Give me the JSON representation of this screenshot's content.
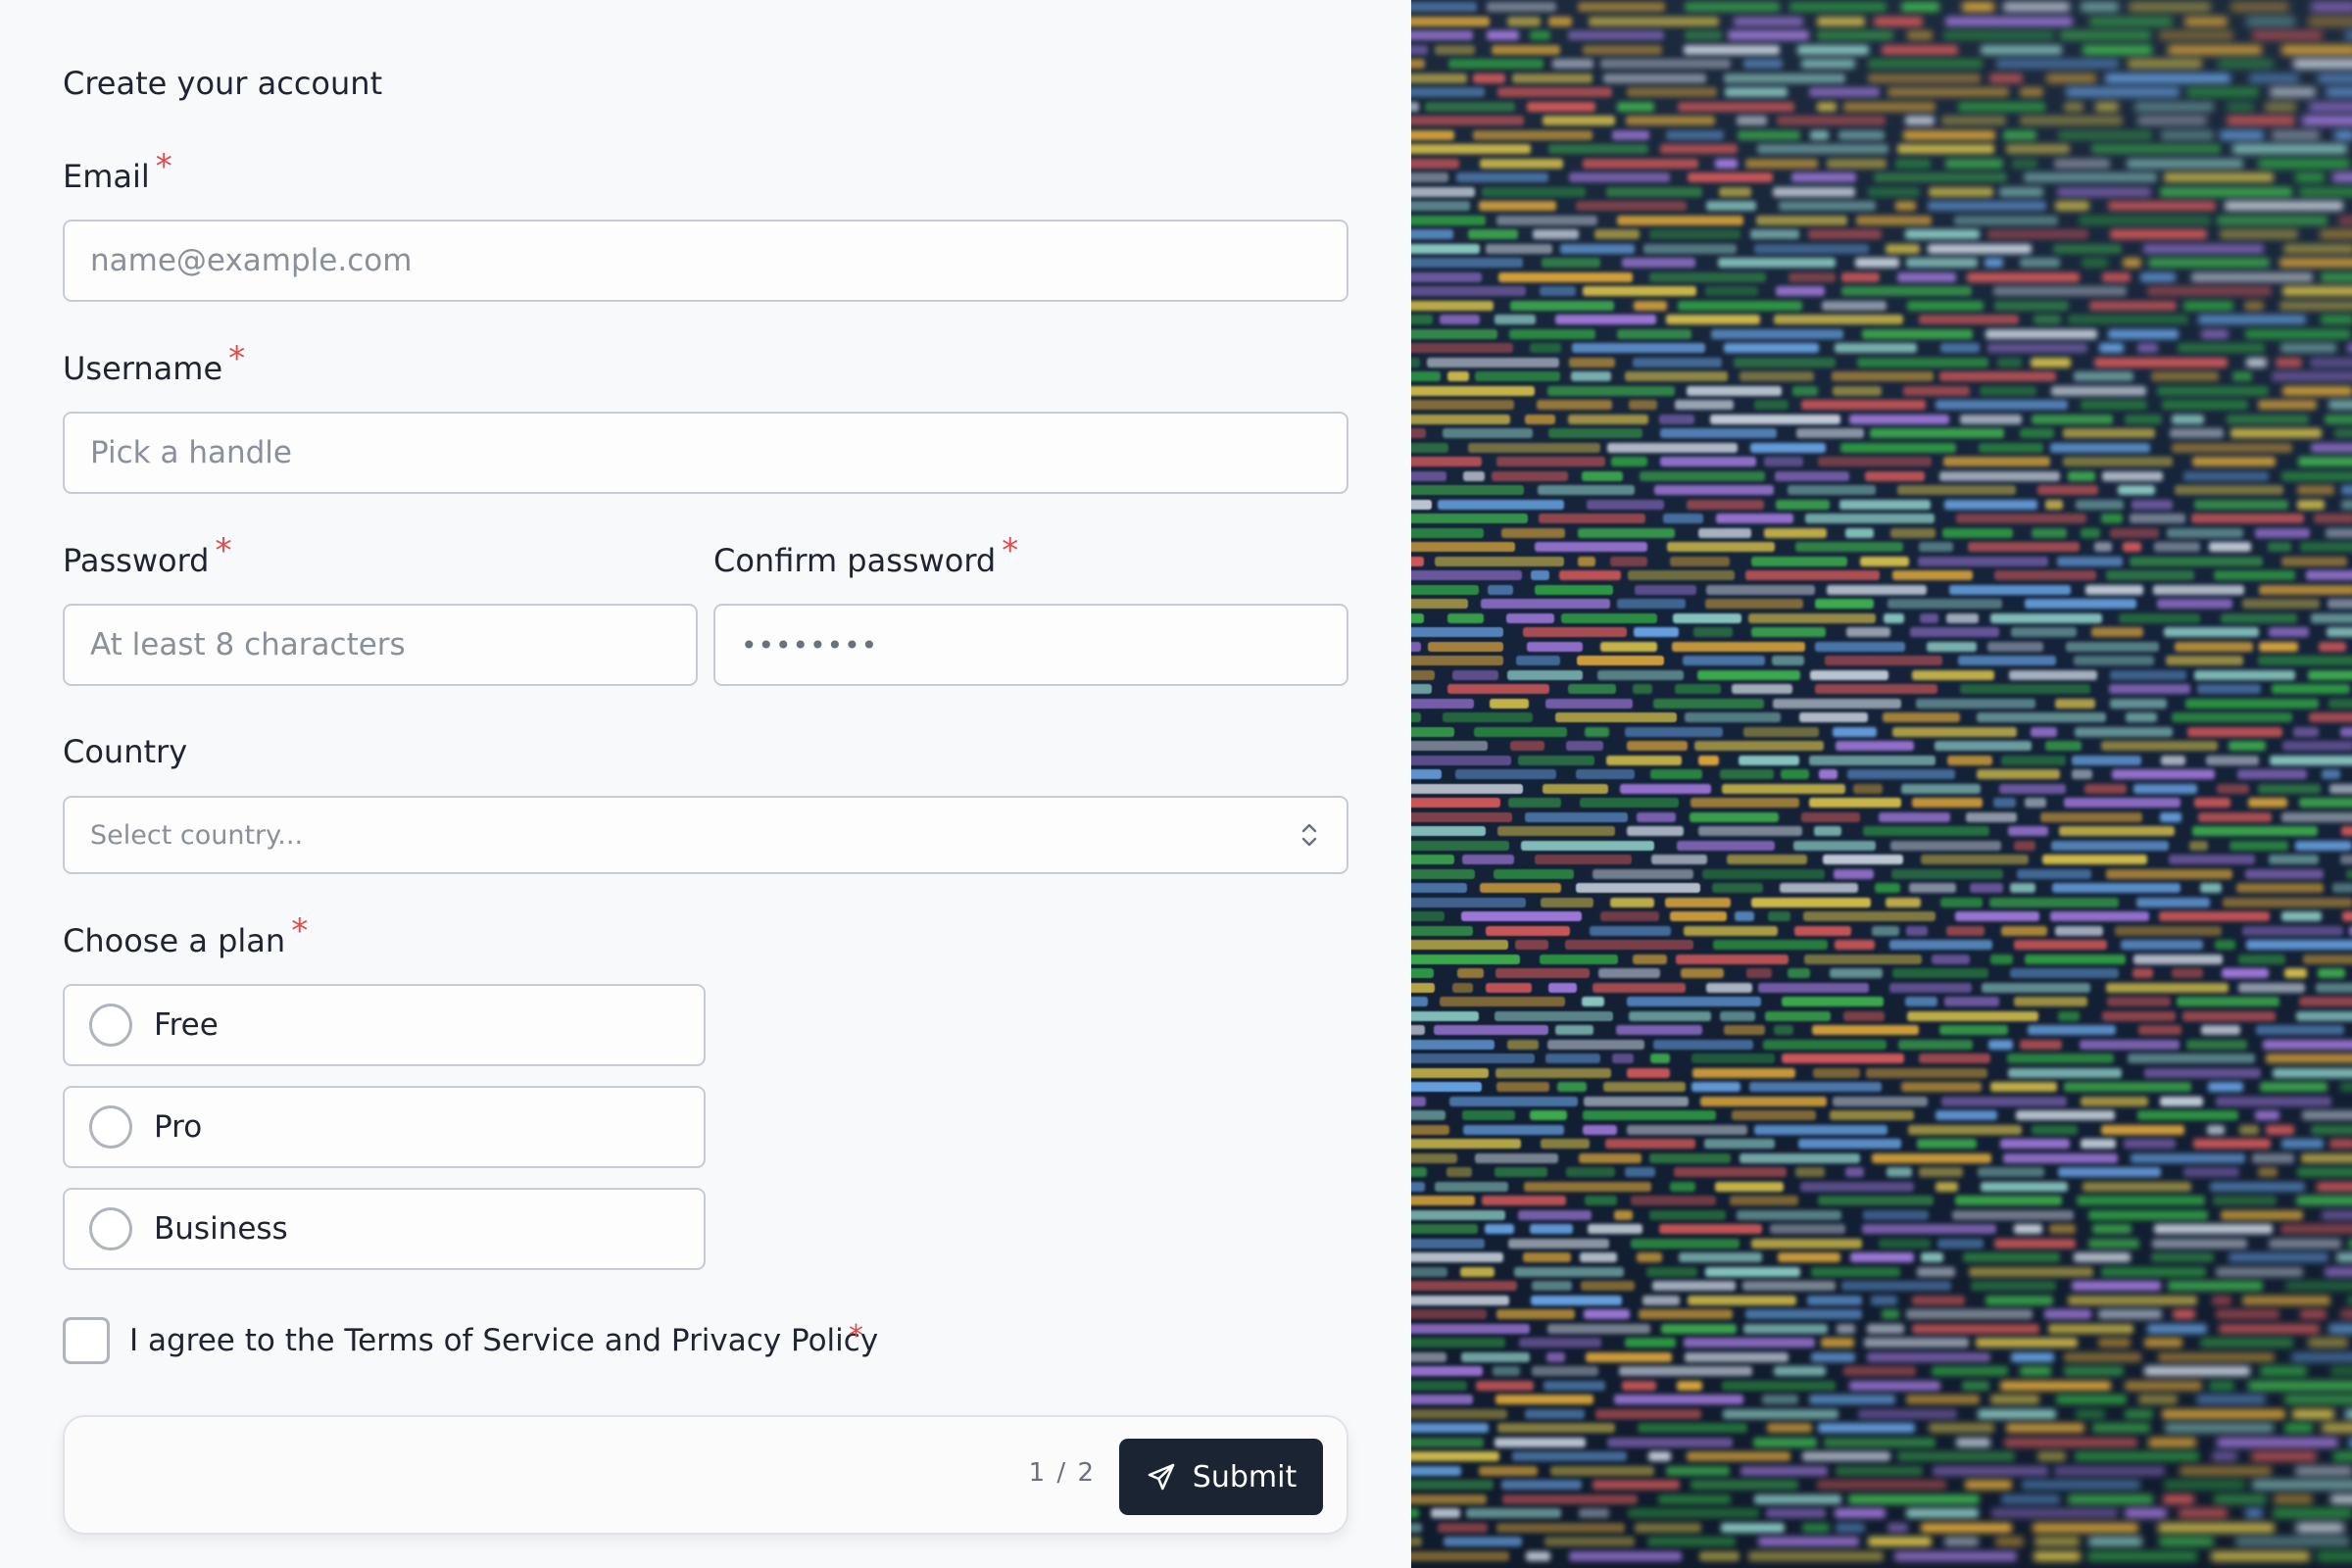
{
  "form": {
    "title": "Create your account",
    "email": {
      "label": "Email",
      "required_mark": "*",
      "placeholder": "name@example.com"
    },
    "username": {
      "label": "Username",
      "required_mark": "*",
      "placeholder": "Pick a handle"
    },
    "password": {
      "label": "Password",
      "required_mark": "*",
      "placeholder": "At least 8 characters"
    },
    "confirm_password": {
      "label": "Confirm password",
      "required_mark": "*",
      "value": "••••••••"
    },
    "country": {
      "label": "Country",
      "placeholder": "Select country...",
      "icon": "chevron-up-down-icon"
    },
    "plan": {
      "label": "Choose a plan",
      "required_mark": "*",
      "options": [
        {
          "label": "Free",
          "selected": false
        },
        {
          "label": "Pro",
          "selected": false
        },
        {
          "label": "Business",
          "selected": false
        }
      ]
    },
    "terms": {
      "label": "I agree to the Terms of Service and Privacy Policy",
      "required_mark": "*",
      "checked": false
    },
    "footer": {
      "step": "1 / 2",
      "submit_label": "Submit",
      "submit_icon": "send-icon"
    }
  },
  "colors": {
    "required": "#e14b4b",
    "button_bg": "#1b2433",
    "border": "#c7ccd4"
  }
}
